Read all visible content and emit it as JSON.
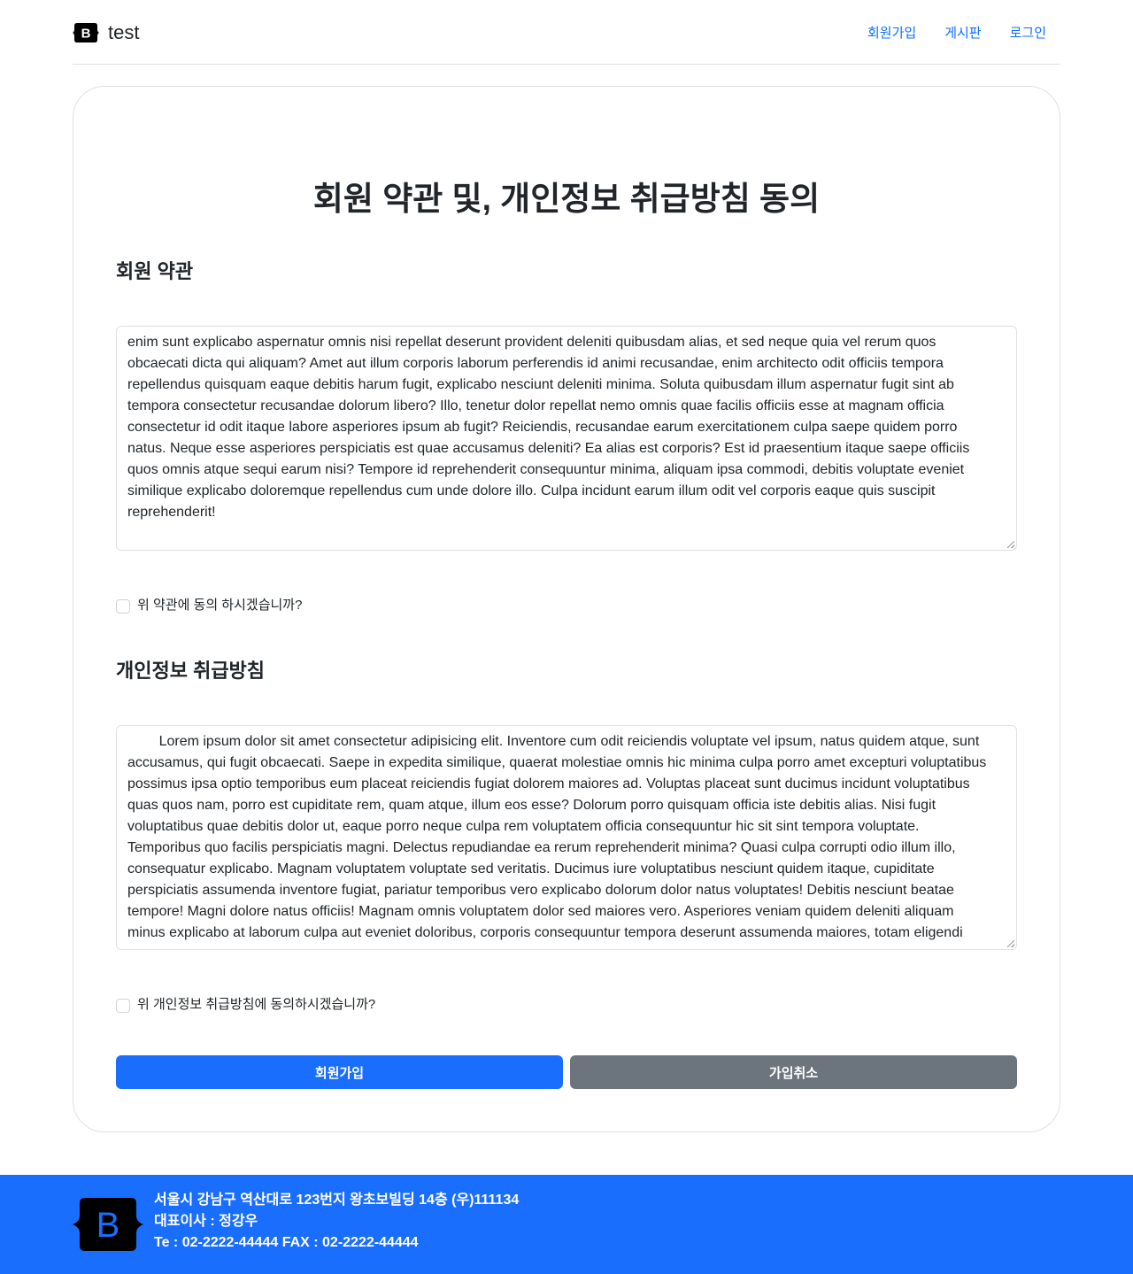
{
  "header": {
    "brand_letter": "B",
    "brand_name": "test",
    "nav": [
      "회원가입",
      "게시판",
      "로그인"
    ]
  },
  "main": {
    "title": "회원 약관 및, 개인정보 취급방침 동의",
    "terms": {
      "heading": "회원 약관",
      "lines": [
        "enim sunt explicabo aspernatur omnis nisi repellat deserunt provident deleniti quibusdam alias, et sed neque quia vel rerum quos",
        "obcaecati dicta qui aliquam? Amet aut illum corporis laborum perferendis id animi recusandae, enim architecto odit officiis tempora",
        "repellendus quisquam eaque debitis harum fugit, explicabo nesciunt deleniti minima. Soluta quibusdam illum aspernatur fugit sint ab",
        "tempora consectetur recusandae dolorum libero? Illo, tenetur dolor repellat nemo omnis quae facilis officiis esse at magnam officia",
        "consectetur id odit itaque labore asperiores ipsum ab fugit? Reiciendis, recusandae earum exercitationem culpa saepe quidem porro",
        "natus. Neque esse asperiores perspiciatis est quae accusamus deleniti? Ea alias est corporis? Est id praesentium itaque saepe officiis",
        "quos omnis atque sequi earum nisi? Tempore id reprehenderit consequuntur minima, aliquam ipsa commodi, debitis voluptate eveniet",
        "similique explicabo doloremque repellendus cum unde dolore illo. Culpa incidunt earum illum odit vel corporis eaque quis suscipit",
        "reprehenderit!"
      ],
      "agree_label": "위 약관에 동의 하시겠습니까?"
    },
    "privacy": {
      "heading": "개인정보 취급방침",
      "lines": [
        "        Lorem ipsum dolor sit amet consectetur adipisicing elit. Inventore cum odit reiciendis voluptate vel ipsum, natus quidem atque, sunt",
        "accusamus, qui fugit obcaecati. Saepe in expedita similique, quaerat molestiae omnis hic minima culpa porro amet excepturi voluptatibus",
        "possimus ipsa optio temporibus eum placeat reiciendis fugiat dolorem maiores ad. Voluptas placeat sunt ducimus incidunt voluptatibus",
        "quas quos nam, porro est cupiditate rem, quam atque, illum eos esse? Dolorum porro quisquam officia iste debitis alias. Nisi fugit",
        "voluptatibus quae debitis dolor ut, eaque porro neque culpa rem voluptatem officia consequuntur hic sit sint tempora voluptate.",
        "Temporibus quo facilis perspiciatis magni. Delectus repudiandae ea rerum reprehenderit minima? Quasi culpa corrupti odio illum illo,",
        "consequatur explicabo. Magnam voluptatem voluptate sed veritatis. Ducimus iure voluptatibus nesciunt quidem itaque, cupiditate",
        "perspiciatis assumenda inventore fugiat, pariatur temporibus vero explicabo dolorum dolor natus voluptates! Debitis nesciunt beatae",
        "tempore! Magni dolore natus officiis! Magnam omnis voluptatem dolor sed maiores vero. Asperiores veniam quidem deleniti aliquam",
        "minus explicabo at laborum culpa aut eveniet doloribus, corporis consequuntur tempora deserunt assumenda maiores, totam eligendi"
      ],
      "agree_label": "위 개인정보 취급방침에 동의하시겠습니까?"
    },
    "buttons": {
      "signup": "회원가입",
      "cancel": "가입취소"
    }
  },
  "footer": {
    "logo_letter": "B",
    "address": "서울시 강남구 역산대로 123번지 왕초보빌딩 14층 (우)111134",
    "ceo": "대표이사 : 정강우",
    "contact": "Te : 02-2222-44444 FAX : 02-2222-44444"
  },
  "colors": {
    "primary": "#1a6efd",
    "secondary": "#6c757d",
    "link": "#0d6efd"
  }
}
